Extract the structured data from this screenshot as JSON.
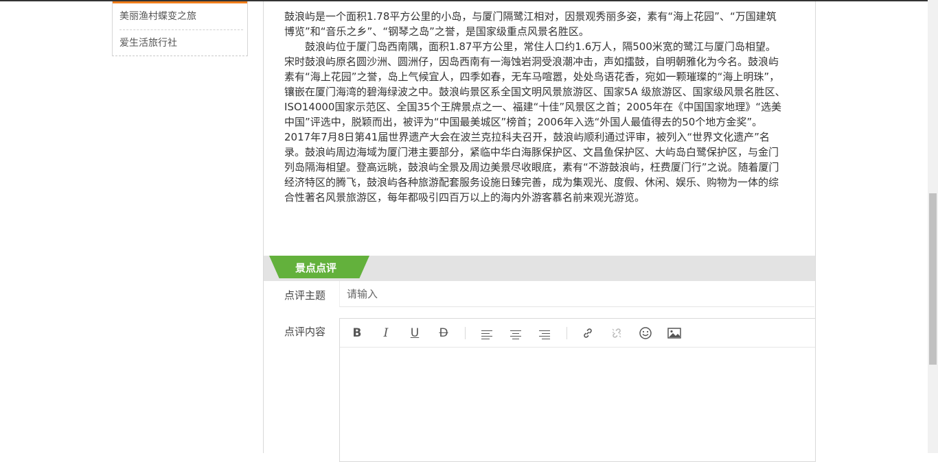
{
  "sidebar": {
    "items": [
      {
        "label": "美丽渔村蝶变之旅"
      },
      {
        "label": "爱生活旅行社"
      }
    ],
    "accent_color": "#f07e1b"
  },
  "article": {
    "paragraphs": [
      "鼓浪屿是一个面积1.78平方公里的小岛，与厦门隔鹭江相对，因景观秀丽多姿，素有“海上花园”、“万国建筑博览”和“音乐之乡”、“钢琴之岛”之誉，是国家级重点风景名胜区。",
      "鼓浪屿位于厦门岛西南隅，面积1.87平方公里，常住人口约1.6万人，隔500米宽的鹭江与厦门岛相望。宋时鼓浪屿原名圆沙洲、圆洲仔，因岛西南有一海蚀岩洞受浪潮冲击，声如擂鼓，自明朝雅化为今名。鼓浪屿素有“海上花园”之誉，岛上气候宜人，四季如春，无车马喧嚣，处处鸟语花香，宛如一颗璀璨的“海上明珠”，镶嵌在厦门海湾的碧海绿波之中。鼓浪屿景区系全国文明风景旅游区、国家5A 级旅游区、国家级风景名胜区、ISO14000国家示范区、全国35个王牌景点之一、福建“十佳”风景区之首；2005年在《中国国家地理》“选美中国”评选中，脱颖而出，被评为“中国最美城区”榜首；2006年入选“外国人最值得去的50个地方金奖”。2017年7月8日第41届世界遗产大会在波兰克拉科夫召开，鼓浪屿顺利通过评审，被列入“世界文化遗产”名录。鼓浪屿周边海域为厦门港主要部分，紧临中华白海豚保护区、文昌鱼保护区、大屿岛白鹭保护区，与金门列岛隔海相望。登高远眺，鼓浪屿全景及周边美景尽收眼底，素有“不游鼓浪屿，枉费厦门行”之说。随着厦门经济特区的腾飞，鼓浪屿各种旅游配套服务设施日臻完善，成为集观光、度假、休闲、娱乐、购物为一体的综合性著名风景旅游区，每年都吸引四百万以上的海内外游客慕名前来观光游览。"
    ]
  },
  "review": {
    "section_title": "景点点评",
    "tab_color": "#63b13c",
    "subject_label": "点评主题",
    "subject_placeholder": "请输入",
    "content_label": "点评内容"
  },
  "toolbar": {
    "bold": "B",
    "italic": "I",
    "underline": "U",
    "strikethrough": "D",
    "buttons": [
      "bold",
      "italic",
      "underline",
      "strikethrough",
      "align-left",
      "align-center",
      "align-right",
      "link",
      "unlink",
      "emoji",
      "image"
    ]
  }
}
